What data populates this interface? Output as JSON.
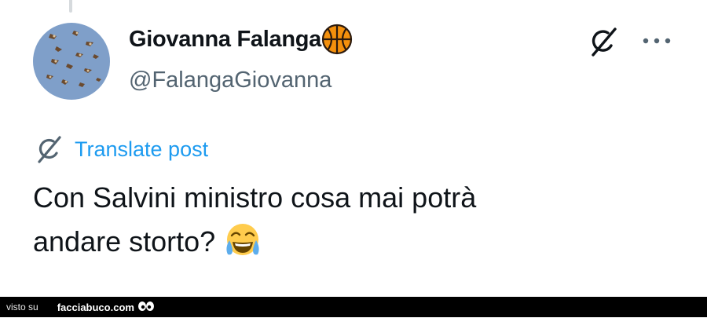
{
  "post": {
    "author": {
      "display_name": "Giovanna Falanga",
      "handle": "@FalangaGiovanna",
      "name_emoji": "basketball-icon"
    },
    "translate_label": "Translate post",
    "text_lines": [
      "Con Salvini ministro cosa mai potrà",
      "andare storto?"
    ],
    "trailing_emoji": "face-with-tears-of-joy-emoji",
    "actions": [
      "grok-icon",
      "more-options-icon"
    ]
  },
  "watermark": {
    "prefix": "visto su",
    "site": "facciabuco.com"
  },
  "colors": {
    "text": "#0f1419",
    "secondary": "#536471",
    "link": "#1d9bf0",
    "footer_bg": "#000000"
  }
}
